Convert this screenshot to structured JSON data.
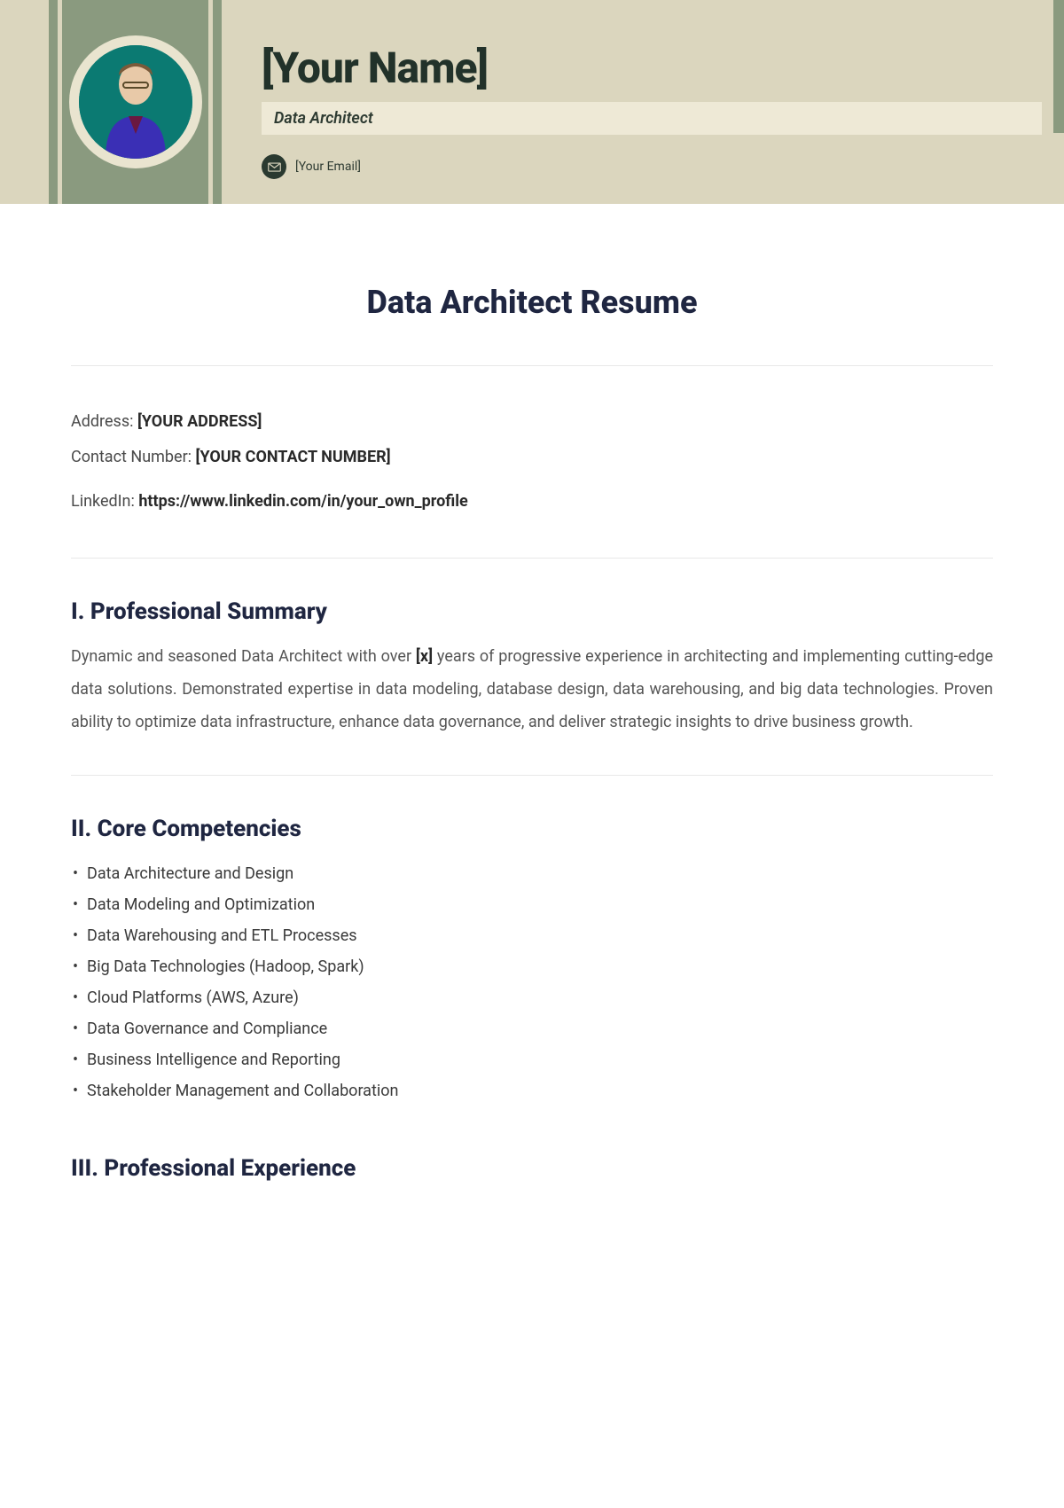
{
  "header": {
    "name": "[Your Name]",
    "role": "Data Architect",
    "email": "[Your Email]"
  },
  "doc_title": "Data Architect Resume",
  "contact": {
    "address_label": "Address: ",
    "address_value": "[YOUR ADDRESS]",
    "phone_label": "Contact Number: ",
    "phone_value": "[YOUR CONTACT NUMBER]",
    "linkedin_label": "LinkedIn: ",
    "linkedin_value": "https://www.linkedin.com/in/your_own_profile"
  },
  "sections": {
    "summary_title": "I. Professional Summary",
    "summary_pre": "Dynamic and seasoned Data Architect with over ",
    "summary_years": "[x]",
    "summary_post": " years of progressive experience in architecting and implementing cutting-edge data solutions. Demonstrated expertise in data modeling, database design, data warehousing, and big data technologies. Proven ability to optimize data infrastructure, enhance data governance, and deliver strategic insights to drive business growth.",
    "competencies_title": "II. Core Competencies",
    "competencies": [
      "Data Architecture and Design",
      "Data Modeling and Optimization",
      "Data Warehousing and ETL Processes",
      "Big Data Technologies (Hadoop, Spark)",
      "Cloud Platforms (AWS, Azure)",
      "Data Governance and Compliance",
      "Business Intelligence and Reporting",
      "Stakeholder Management and Collaboration"
    ],
    "experience_title": "III. Professional Experience"
  }
}
